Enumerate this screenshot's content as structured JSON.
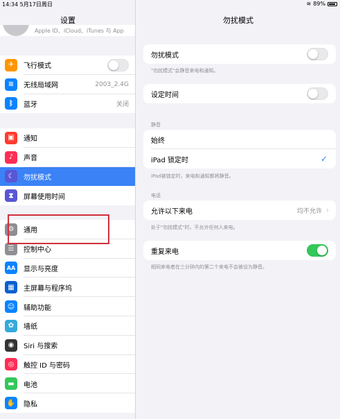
{
  "status_bar": {
    "time_date": "14:34  5月17日周日",
    "battery": "89%"
  },
  "sidebar": {
    "title": "设置",
    "profile_subtitle": "Apple ID、iCloud、iTunes 与 App",
    "groups": [
      {
        "items": [
          {
            "label": "飞行模式",
            "icon": "airplane-icon",
            "color": "#ff9500",
            "glyph": "✈",
            "toggle": "off"
          },
          {
            "label": "无线局域网",
            "icon": "wifi-icon",
            "color": "#0a84ff",
            "glyph": "≋",
            "value": "2003_2.4G"
          },
          {
            "label": "蓝牙",
            "icon": "bluetooth-icon",
            "color": "#0a84ff",
            "glyph": "ᛒ",
            "value": "关闭"
          }
        ]
      },
      {
        "items": [
          {
            "label": "通知",
            "icon": "notifications-icon",
            "color": "#ff3b30",
            "glyph": "▣"
          },
          {
            "label": "声音",
            "icon": "sound-icon",
            "color": "#ff2d55",
            "glyph": "♪"
          },
          {
            "label": "勿扰模式",
            "icon": "moon-icon",
            "color": "#5856d6",
            "glyph": "☾",
            "selected": true
          },
          {
            "label": "屏幕使用时间",
            "icon": "hourglass-icon",
            "color": "#5856d6",
            "glyph": "⧗"
          }
        ]
      },
      {
        "items": [
          {
            "label": "通用",
            "icon": "gear-icon",
            "color": "#8e8e93",
            "glyph": "⚙"
          },
          {
            "label": "控制中心",
            "icon": "control-center-icon",
            "color": "#8e8e93",
            "glyph": "☰"
          },
          {
            "label": "显示与亮度",
            "icon": "display-icon",
            "color": "#0a84ff",
            "glyph": "AA"
          },
          {
            "label": "主屏幕与程序坞",
            "icon": "home-screen-icon",
            "color": "#0a60d0",
            "glyph": "▦"
          },
          {
            "label": "辅助功能",
            "icon": "accessibility-icon",
            "color": "#0a84ff",
            "glyph": "☺"
          },
          {
            "label": "墙纸",
            "icon": "wallpaper-icon",
            "color": "#34aadc",
            "glyph": "✿"
          },
          {
            "label": "Siri 与搜索",
            "icon": "siri-icon",
            "color": "#333333",
            "glyph": "◉"
          },
          {
            "label": "触控 ID 与密码",
            "icon": "fingerprint-icon",
            "color": "#ff2d55",
            "glyph": "◎"
          },
          {
            "label": "电池",
            "icon": "battery-icon",
            "color": "#34c759",
            "glyph": "▬"
          },
          {
            "label": "隐私",
            "icon": "hand-icon",
            "color": "#0a84ff",
            "glyph": "✋"
          }
        ]
      }
    ]
  },
  "detail": {
    "title": "勿扰模式",
    "dnd": {
      "label": "勿扰模式",
      "toggle": "off",
      "footer": "\"勿扰模式\"会静音来电和通知。"
    },
    "scheduled": {
      "label": "设定时间",
      "toggle": "off"
    },
    "silence_header": "静音",
    "silence_options": [
      {
        "label": "始终",
        "checked": false
      },
      {
        "label": "iPad 锁定时",
        "checked": true
      }
    ],
    "silence_footer": "iPad被锁定时，来电和通知都将静音。",
    "phone_header": "电话",
    "allow_calls": {
      "label": "允许以下来电",
      "value": "均不允许"
    },
    "allow_calls_footer": "处于\"勿扰模式\"时，不允许任何人来电。",
    "repeated_calls": {
      "label": "重复来电",
      "toggle": "on"
    },
    "repeated_calls_footer": "相同来电者在三分钟内的第二个来电不会被设为静音。"
  },
  "colors": {
    "accent": "#3a82f6",
    "switch_on": "#34c759",
    "highlight_box": "#d0303c"
  }
}
